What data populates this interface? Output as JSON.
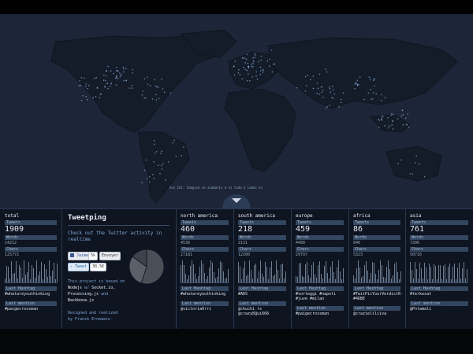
{
  "map": {
    "tweet_bubble": "Ace Idi: Imagine se acabaris e ni toda a lados os"
  },
  "brand": {
    "title": "Tweetping",
    "tagline": "Check out the Twitter activity in realtime",
    "share": {
      "fb_label": "Jaime",
      "fb_count": "5k",
      "envoyer_label": "Envoyer",
      "tweet_label": "Tweet",
      "tweet_count": "38.5K"
    },
    "about_prefix": "This project is based on",
    "about_tech": [
      "Nodejs",
      "Socket.io,",
      "Processing.js",
      "Backbone.js"
    ],
    "credit_line1": "Designed and realized",
    "credit_line2": "by Franck Ernewein"
  },
  "labels": {
    "tweets": "Tweets",
    "words": "Words",
    "chars": "Chars",
    "last_hashtag": "Last Hashtag",
    "last_mention": "Last mention"
  },
  "columns": [
    {
      "name": "total",
      "tweets": "1909",
      "words": "14212",
      "chars": "125772",
      "hashtag": "#whatareyouthinking",
      "mention": "#paigecrossman"
    },
    {
      "name": "north america",
      "tweets": "460",
      "words": "4536",
      "chars": "27181",
      "hashtag": "#whatareyouthinking",
      "mention": "@victoriaOrri"
    },
    {
      "name": "south america",
      "tweets": "218",
      "words": "2131",
      "chars": "12200",
      "hashtag": "#ADS",
      "mention": "@chuchi_rs @crazy8gui666"
    },
    {
      "name": "europe",
      "tweets": "459",
      "words": "4490",
      "chars": "29797",
      "hashtag": "#sorteggi #napoli #juve #milan",
      "mention": "#paigecrossman"
    },
    {
      "name": "africa",
      "tweets": "86",
      "words": "846",
      "chars": "5323",
      "hashtag": "#TwitPicYourVerdictK-#4DBE",
      "mention": "@crazieliliiva"
    },
    {
      "name": "asia",
      "tweets": "761",
      "words": "7206",
      "chars": "50716",
      "hashtag": "#terkesat",
      "mention": "@Pntamali"
    }
  ],
  "pie": {
    "values": [
      55,
      30,
      15
    ]
  }
}
